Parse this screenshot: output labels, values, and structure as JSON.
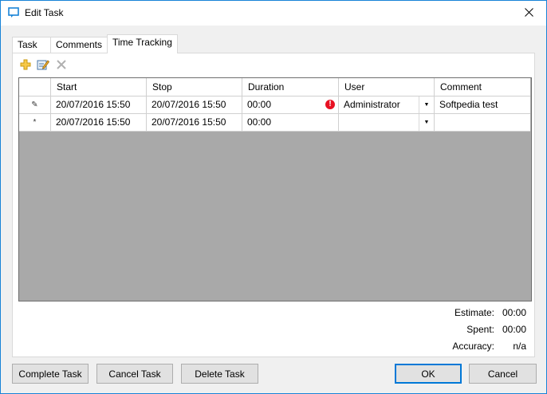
{
  "window": {
    "title": "Edit Task",
    "close_icon": "close-icon",
    "app_icon": "window-icon"
  },
  "tabs": [
    {
      "label": "Task",
      "active": false
    },
    {
      "label": "Comments",
      "active": false
    },
    {
      "label": "Time Tracking",
      "active": true
    }
  ],
  "toolbar": {
    "buttons": [
      {
        "icon": "add-icon",
        "enabled": true
      },
      {
        "icon": "edit-icon",
        "enabled": true
      },
      {
        "icon": "delete-icon",
        "enabled": false
      }
    ]
  },
  "grid": {
    "columns": [
      "",
      "Start",
      "Stop",
      "Duration",
      "User",
      "Comment"
    ],
    "rows": [
      {
        "indicator": "✎",
        "start": "20/07/2016  15:50",
        "stop": "20/07/2016  15:50",
        "duration": "00:00",
        "error_icon": "!",
        "user": "Administrator",
        "comment": "Softpedia test"
      },
      {
        "indicator": "*",
        "start": "20/07/2016  15:50",
        "stop": "20/07/2016  15:50",
        "duration": "00:00",
        "user": "",
        "comment": ""
      }
    ]
  },
  "stats": {
    "estimate_label": "Estimate:",
    "estimate_value": "00:00",
    "spent_label": "Spent:",
    "spent_value": "00:00",
    "accuracy_label": "Accuracy:",
    "accuracy_value": "n/a"
  },
  "buttons": {
    "complete": "Complete Task",
    "cancel_task": "Cancel Task",
    "delete": "Delete Task",
    "ok": "OK",
    "cancel": "Cancel"
  },
  "colors": {
    "accent": "#0078d7",
    "grid_empty": "#a9a9a9",
    "error": "#e81123"
  }
}
